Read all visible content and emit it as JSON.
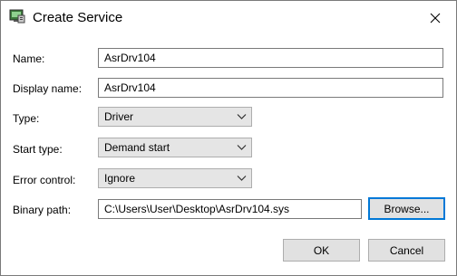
{
  "window": {
    "title": "Create Service",
    "close_glyph": "✕"
  },
  "icons": {
    "app": "service-app-icon",
    "close": "close-icon",
    "dropdown": "chevron-down-icon"
  },
  "fields": {
    "name": {
      "label": "Name:",
      "value": "AsrDrv104"
    },
    "display_name": {
      "label": "Display name:",
      "value": "AsrDrv104"
    },
    "type": {
      "label": "Type:",
      "value": "Driver"
    },
    "start_type": {
      "label": "Start type:",
      "value": "Demand start"
    },
    "error_control": {
      "label": "Error control:",
      "value": "Ignore"
    },
    "binary_path": {
      "label": "Binary path:",
      "value": "C:\\Users\\User\\Desktop\\AsrDrv104.sys"
    }
  },
  "buttons": {
    "browse": "Browse...",
    "ok": "OK",
    "cancel": "Cancel"
  },
  "colors": {
    "focus_border": "#0078d7",
    "button_bg": "#e1e1e1",
    "select_bg": "#e5e5e5"
  }
}
